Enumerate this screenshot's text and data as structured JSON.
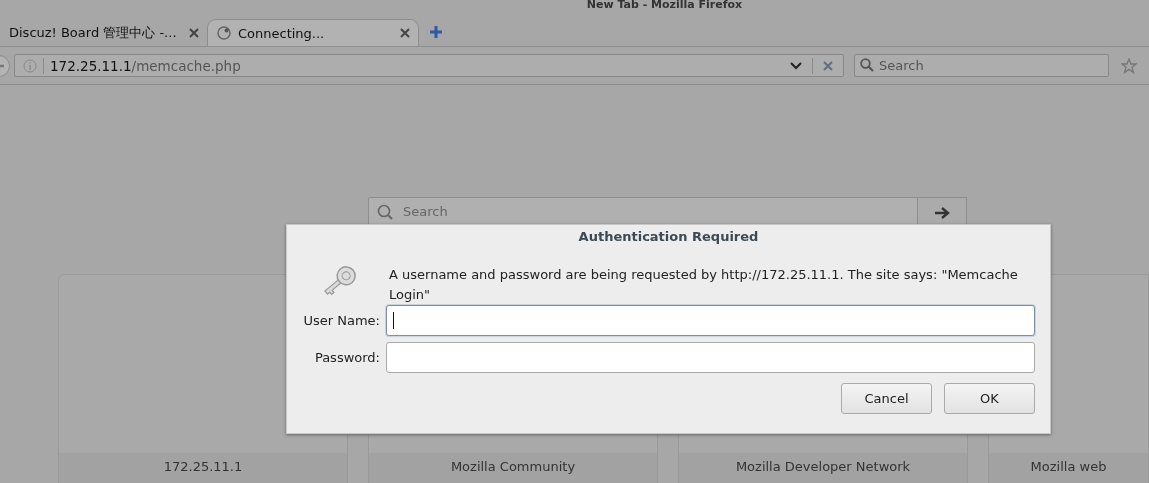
{
  "window": {
    "title": "New Tab - Mozilla Firefox"
  },
  "tabs": [
    {
      "label": "Discuz! Board 管理中心 -...",
      "selected": false,
      "loading": false
    },
    {
      "label": "Connecting...",
      "selected": true,
      "loading": true
    }
  ],
  "address_bar": {
    "host": "172.25.11.1",
    "path": "/memcache.php"
  },
  "search_bar": {
    "placeholder": "Search"
  },
  "page": {
    "search": {
      "placeholder": "Search"
    },
    "tiles": [
      {
        "title": "172.25.11.1"
      },
      {
        "title": "Mozilla Community"
      },
      {
        "title": "Mozilla Developer Network"
      },
      {
        "title": "Mozilla web"
      }
    ]
  },
  "dialog": {
    "title": "Authentication Required",
    "message": "A username and password are being requested by http://172.25.11.1. The site says: \"Memcache Login\"",
    "fields": [
      {
        "label": "User Name:",
        "focused": true
      },
      {
        "label": "Password:",
        "focused": false
      }
    ],
    "buttons": [
      "Cancel",
      "OK"
    ]
  }
}
